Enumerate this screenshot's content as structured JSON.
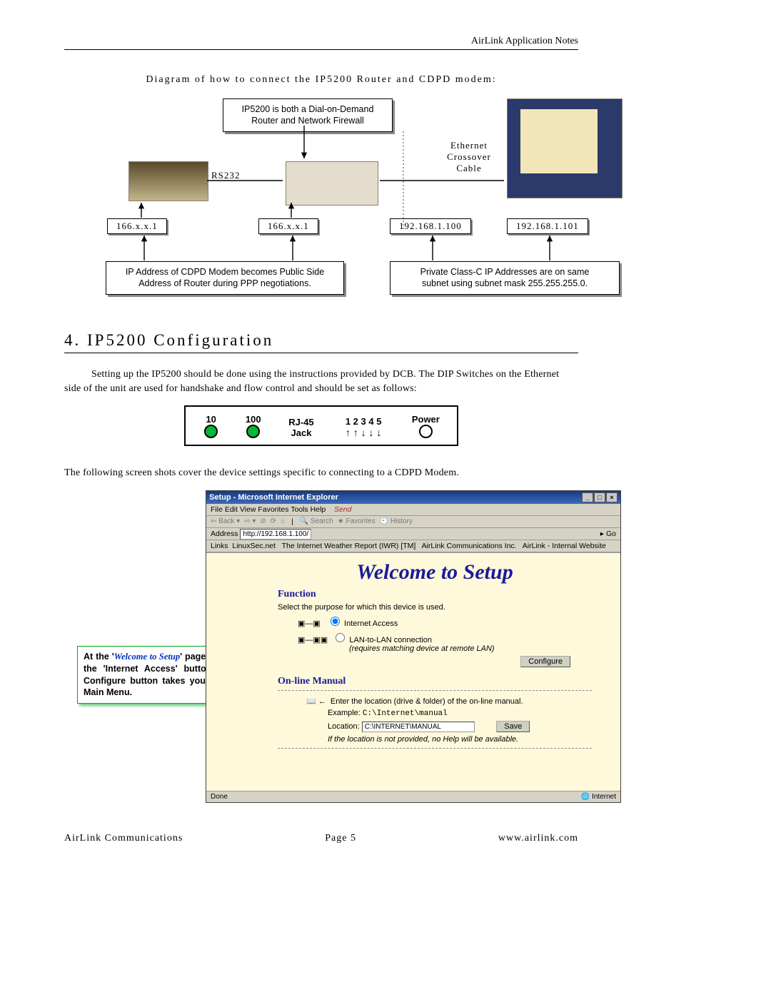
{
  "header": {
    "right": "AirLink Application Notes"
  },
  "diagram": {
    "caption": "Diagram of how to connect the IP5200 Router and CDPD modem:",
    "top_box_line1": "IP5200 is both a Dial-on-Demand",
    "top_box_line2": "Router and Network Firewall",
    "rs232_label": "RS232",
    "eth_label_l1": "Ethernet",
    "eth_label_l2": "Crossover",
    "eth_label_l3": "Cable",
    "ip": [
      "166.x.x.1",
      "166.x.x.1",
      "192.168.1.100",
      "192.168.1.101"
    ],
    "bottom_left_l1": "IP Address of CDPD Modem becomes Public Side",
    "bottom_left_l2": "Address of Router during PPP negotiations.",
    "bottom_right_l1": "Private Class-C IP Addresses are on same",
    "bottom_right_l2": "subnet using subnet mask 255.255.255.0."
  },
  "section": {
    "title": "4. IP5200 Configuration"
  },
  "para1": "Setting up the IP5200 should be done using the instructions provided by DCB.  The DIP Switches on the Ethernet side of the unit are used for handshake and flow control and should be set as follows:",
  "dip": {
    "c1": "10",
    "c2": "100",
    "c3": "RJ-45",
    "c3b": "Jack",
    "c4": "1 2 3 4 5",
    "arrows": "↑ ↑ ↓ ↓ ↓",
    "c5": "Power"
  },
  "para2": "The following screen shots cover the device settings specific to connecting to a CDPD Modem.",
  "callout": {
    "t1": "At the '",
    "wts": "Welcome to Setup",
    "t2": "' page, select the 'Internet Access' button. The Configure button takes you to the Main Menu."
  },
  "browser": {
    "title": "Setup - Microsoft Internet Explorer",
    "menu": "File   Edit   View   Favorites   Tools   Help",
    "toolbar": {
      "back": "Back",
      "search": "Search",
      "fav": "Favorites",
      "hist": "History"
    },
    "address_label": "Address",
    "address_value": "http://192.168.1.100/",
    "go": "Go",
    "links_label": "Links",
    "links": [
      "LinuxSec.net",
      "The Internet Weather Report (IWR) [TM]",
      "AirLink Communications Inc.",
      "AirLink - Internal Website"
    ],
    "welcome": "Welcome to Setup",
    "function_hdr": "Function",
    "function_desc": "Select the purpose for which this device is used.",
    "opt1": "Internet Access",
    "opt2": "LAN-to-LAN connection",
    "opt2_note": "(requires matching device at remote LAN)",
    "configure_btn": "Configure",
    "manual_hdr": "On-line Manual",
    "manual_desc": "Enter the location (drive & folder) of the on-line manual.",
    "example_label": "Example:",
    "example_value": "C:\\Internet\\manual",
    "location_label": "Location:",
    "location_value": "C:\\INTERNET\\MANUAL",
    "save_btn": "Save",
    "manual_note": "If the location is not provided, no Help will be available.",
    "status_done": "Done",
    "status_zone": "Internet"
  },
  "footer": {
    "left": "AirLink Communications",
    "center": "Page 5",
    "right": "www.airlink.com"
  }
}
